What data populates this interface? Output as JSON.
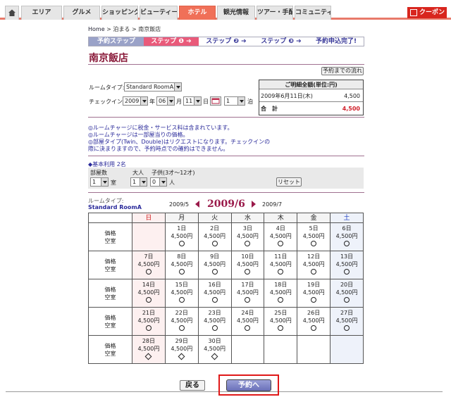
{
  "nav": {
    "tabs": [
      "エリア",
      "グルメ",
      "ショッピング",
      "ビューティー",
      "ホテル",
      "観光情報",
      "ツアー・手配",
      "コミュニティ"
    ],
    "active_index": 4,
    "coupon": "クーポン"
  },
  "breadcrumb": {
    "home": "Home",
    "sep1": ">",
    "stay": "泊まる",
    "sep2": ">",
    "current": "南京飯店"
  },
  "steps": [
    {
      "label": "予約ステップ"
    },
    {
      "label": "ステップ ❶ ➔"
    },
    {
      "label": "ステップ ❷ ➔"
    },
    {
      "label": "ステップ ❸ ➔"
    },
    {
      "label": "予約申込完了!"
    }
  ],
  "hotel_name": "南京飯店",
  "flow_button": "予約までの流れ",
  "room_type_label": "ルームタイプ:",
  "room_type_value": "Standard RoomA",
  "checkin_label": "チェックイン:",
  "checkin": {
    "year": "2009",
    "year_unit": "年",
    "month": "06",
    "month_unit": "月",
    "day": "11",
    "day_unit": "日",
    "nights": "1",
    "nights_unit": "泊"
  },
  "summary": {
    "title": "ご明細全額(単位:円)",
    "date_row": "2009年6月11日(木)",
    "date_price": "4,500",
    "total_label": "合　計",
    "total_price": "4,500"
  },
  "notes": [
    "◎ルームチャージに税金・サービス料は含まれています。",
    "◎ルームチャージは一部屋当りの価格。",
    "◎部屋タイプ(Twin、Double)はリクエストになります。チェックインの",
    "際に決まりますので、予約時点での確約はできません。"
  ],
  "base_usage": "◆基本利用 2名",
  "rooms_label": "部屋数",
  "rooms_value": "1",
  "rooms_unit": "室",
  "adults_label": "大人",
  "adults_value": "1",
  "children_label": "子供(3才～12才)",
  "children_value": "0",
  "children_unit": "人",
  "reset_button": "リセット",
  "calendar": {
    "room_type_label": "ルームタイプ:",
    "room_type_value": "Standard RoomA",
    "prev": "2009/5",
    "current": "2009/6",
    "next": "2009/7",
    "weekdays": [
      "日",
      "月",
      "火",
      "水",
      "木",
      "金",
      "土"
    ],
    "row_label_price": "価格",
    "row_label_vacancy": "空室",
    "weeks": [
      [
        null,
        {
          "d": "1日",
          "p": "4,500円",
          "s": "○"
        },
        {
          "d": "2日",
          "p": "4,500円",
          "s": "○"
        },
        {
          "d": "3日",
          "p": "4,500円",
          "s": "○"
        },
        {
          "d": "4日",
          "p": "4,500円",
          "s": "○"
        },
        {
          "d": "5日",
          "p": "4,500円",
          "s": "○"
        },
        {
          "d": "6日",
          "p": "4,500円",
          "s": "○"
        }
      ],
      [
        {
          "d": "7日",
          "p": "4,500円",
          "s": "○"
        },
        {
          "d": "8日",
          "p": "4,500円",
          "s": "○"
        },
        {
          "d": "9日",
          "p": "4,500円",
          "s": "○"
        },
        {
          "d": "10日",
          "p": "4,500円",
          "s": "○"
        },
        {
          "d": "11日",
          "p": "4,500円",
          "s": "○"
        },
        {
          "d": "12日",
          "p": "4,500円",
          "s": "○"
        },
        {
          "d": "13日",
          "p": "4,500円",
          "s": "○"
        }
      ],
      [
        {
          "d": "14日",
          "p": "4,500円",
          "s": "○"
        },
        {
          "d": "15日",
          "p": "4,500円",
          "s": "○"
        },
        {
          "d": "16日",
          "p": "4,500円",
          "s": "○"
        },
        {
          "d": "17日",
          "p": "4,500円",
          "s": "○"
        },
        {
          "d": "18日",
          "p": "4,500円",
          "s": "○"
        },
        {
          "d": "19日",
          "p": "4,500円",
          "s": "○"
        },
        {
          "d": "20日",
          "p": "4,500円",
          "s": "○"
        }
      ],
      [
        {
          "d": "21日",
          "p": "4,500円",
          "s": "○"
        },
        {
          "d": "22日",
          "p": "4,500円",
          "s": "○"
        },
        {
          "d": "23日",
          "p": "4,500円",
          "s": "○"
        },
        {
          "d": "24日",
          "p": "4,500円",
          "s": "○"
        },
        {
          "d": "25日",
          "p": "4,500円",
          "s": "○"
        },
        {
          "d": "26日",
          "p": "4,500円",
          "s": "○"
        },
        {
          "d": "27日",
          "p": "4,500円",
          "s": "○"
        }
      ],
      [
        {
          "d": "28日",
          "p": "4,500円",
          "s": "◇"
        },
        {
          "d": "29日",
          "p": "4,500円",
          "s": "◇"
        },
        {
          "d": "30日",
          "p": "4,500円",
          "s": "◇"
        },
        null,
        null,
        null,
        null
      ]
    ]
  },
  "back_button": "戻る",
  "reserve_button": "予約へ"
}
